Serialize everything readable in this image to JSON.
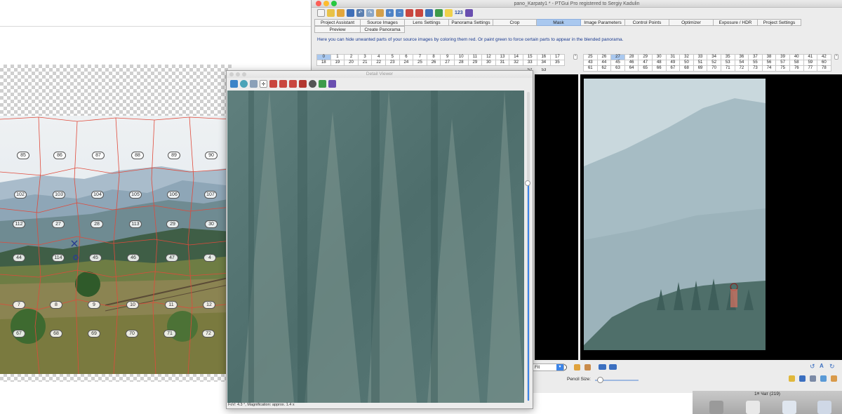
{
  "ptgui": {
    "window_title": "pano_Karpaty1 * - PTGui Pro registered to Sergiy Kadulin",
    "toolbar_counter": "123",
    "tabs_row1": [
      "Project Assistant",
      "Source Images",
      "Lens Settings",
      "Panorama Settings",
      "Crop",
      "Mask",
      "Image Parameters",
      "Control Points",
      "Optimizer",
      "Exposure / HDR",
      "Project Settings"
    ],
    "tabs_row2": [
      "Preview",
      "Create Panorama"
    ],
    "active_tab": "Mask",
    "help_text": "Here you can hide unwanted parts of your source images by coloring them red. Or paint green to force certain parts to appear in the blended panorama.",
    "left_grid": {
      "rows": [
        [
          "0",
          "1",
          "2",
          "3",
          "4",
          "5",
          "6",
          "7",
          "8",
          "9",
          "10",
          "11",
          "12",
          "13",
          "14",
          "15",
          "16",
          "17"
        ],
        [
          "18",
          "19",
          "20",
          "21",
          "22",
          "23",
          "24",
          "25",
          "26",
          "27",
          "28",
          "29",
          "30",
          "31",
          "32",
          "33",
          "34",
          "35"
        ]
      ],
      "partial_row": [
        "52",
        "53"
      ],
      "selected": "0"
    },
    "right_grid": {
      "rows": [
        [
          "25",
          "26",
          "27",
          "28",
          "29",
          "30",
          "31",
          "32",
          "33",
          "34",
          "35",
          "36",
          "37",
          "38",
          "39",
          "40",
          "41",
          "42"
        ],
        [
          "43",
          "44",
          "45",
          "46",
          "47",
          "48",
          "49",
          "50",
          "51",
          "52",
          "53",
          "54",
          "55",
          "56",
          "57",
          "58",
          "59",
          "60"
        ],
        [
          "61",
          "62",
          "63",
          "64",
          "65",
          "66",
          "67",
          "68",
          "69",
          "70",
          "71",
          "72",
          "73",
          "74",
          "75",
          "76",
          "77",
          "78"
        ]
      ],
      "selected": "27"
    },
    "fit_value": "Fit",
    "pencil_size_label": "Pencil Size:",
    "pencil_size_level": 0.05
  },
  "detail_viewer": {
    "title": "Detail Viewer",
    "status": "FoV: 4.3 °, Magnification: approx. 1.4 x"
  },
  "panorama_tiles": [
    {
      "label": "85"
    },
    {
      "label": "86"
    },
    {
      "label": "87"
    },
    {
      "label": "88"
    },
    {
      "label": "89"
    },
    {
      "label": "90"
    },
    {
      "label": "102"
    },
    {
      "label": "103"
    },
    {
      "label": "104"
    },
    {
      "label": "105"
    },
    {
      "label": "106"
    },
    {
      "label": "107"
    },
    {
      "label": "112"
    },
    {
      "label": "27"
    },
    {
      "label": "28"
    },
    {
      "label": "113"
    },
    {
      "label": "29"
    },
    {
      "label": "30"
    },
    {
      "label": "44"
    },
    {
      "label": "114"
    },
    {
      "label": "45"
    },
    {
      "label": "46"
    },
    {
      "label": "47"
    },
    {
      "label": "4"
    },
    {
      "label": "7"
    },
    {
      "label": "8"
    },
    {
      "label": "9"
    },
    {
      "label": "10"
    },
    {
      "label": "11"
    },
    {
      "label": "12"
    },
    {
      "label": "67"
    },
    {
      "label": "68"
    },
    {
      "label": "69"
    },
    {
      "label": "70"
    },
    {
      "label": "71"
    },
    {
      "label": "72"
    }
  ],
  "dock": {
    "label": "1≡ Чат (219)"
  }
}
